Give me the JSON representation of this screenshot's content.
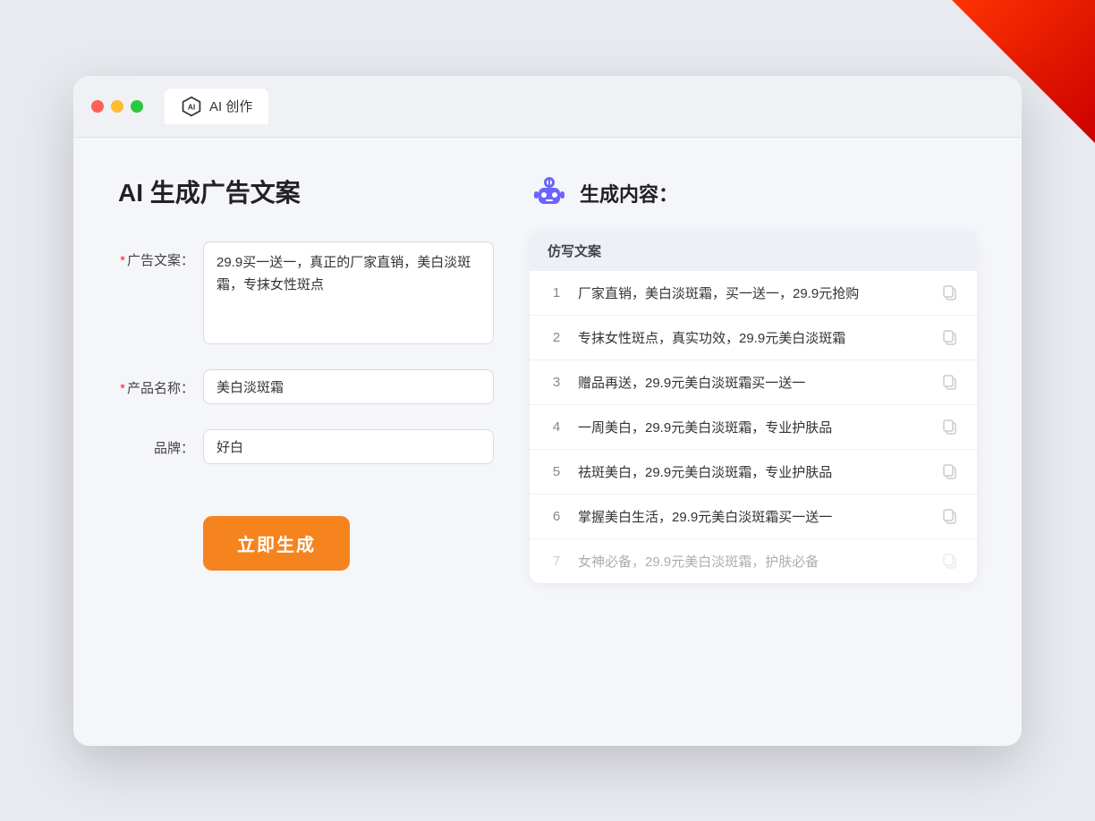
{
  "corner": "decoration",
  "titlebar": {
    "tab_label": "AI 创作"
  },
  "page": {
    "title": "AI 生成广告文案",
    "form": {
      "ad_copy_label": "广告文案：",
      "ad_copy_required": "*",
      "ad_copy_value": "29.9买一送一，真正的厂家直销，美白淡斑霜，专抹女性斑点",
      "product_name_label": "产品名称：",
      "product_name_required": "*",
      "product_name_value": "美白淡斑霜",
      "brand_label": "品牌：",
      "brand_value": "好白",
      "generate_button": "立即生成"
    },
    "result": {
      "header": "生成内容：",
      "table_header": "仿写文案",
      "items": [
        {
          "number": "1",
          "text": "厂家直销，美白淡斑霜，买一送一，29.9元抢购",
          "dimmed": false
        },
        {
          "number": "2",
          "text": "专抹女性斑点，真实功效，29.9元美白淡斑霜",
          "dimmed": false
        },
        {
          "number": "3",
          "text": "赠品再送，29.9元美白淡斑霜买一送一",
          "dimmed": false
        },
        {
          "number": "4",
          "text": "一周美白，29.9元美白淡斑霜，专业护肤品",
          "dimmed": false
        },
        {
          "number": "5",
          "text": "祛斑美白，29.9元美白淡斑霜，专业护肤品",
          "dimmed": false
        },
        {
          "number": "6",
          "text": "掌握美白生活，29.9元美白淡斑霜买一送一",
          "dimmed": false
        },
        {
          "number": "7",
          "text": "女神必备，29.9元美白淡斑霜，护肤必备",
          "dimmed": true
        }
      ]
    }
  }
}
